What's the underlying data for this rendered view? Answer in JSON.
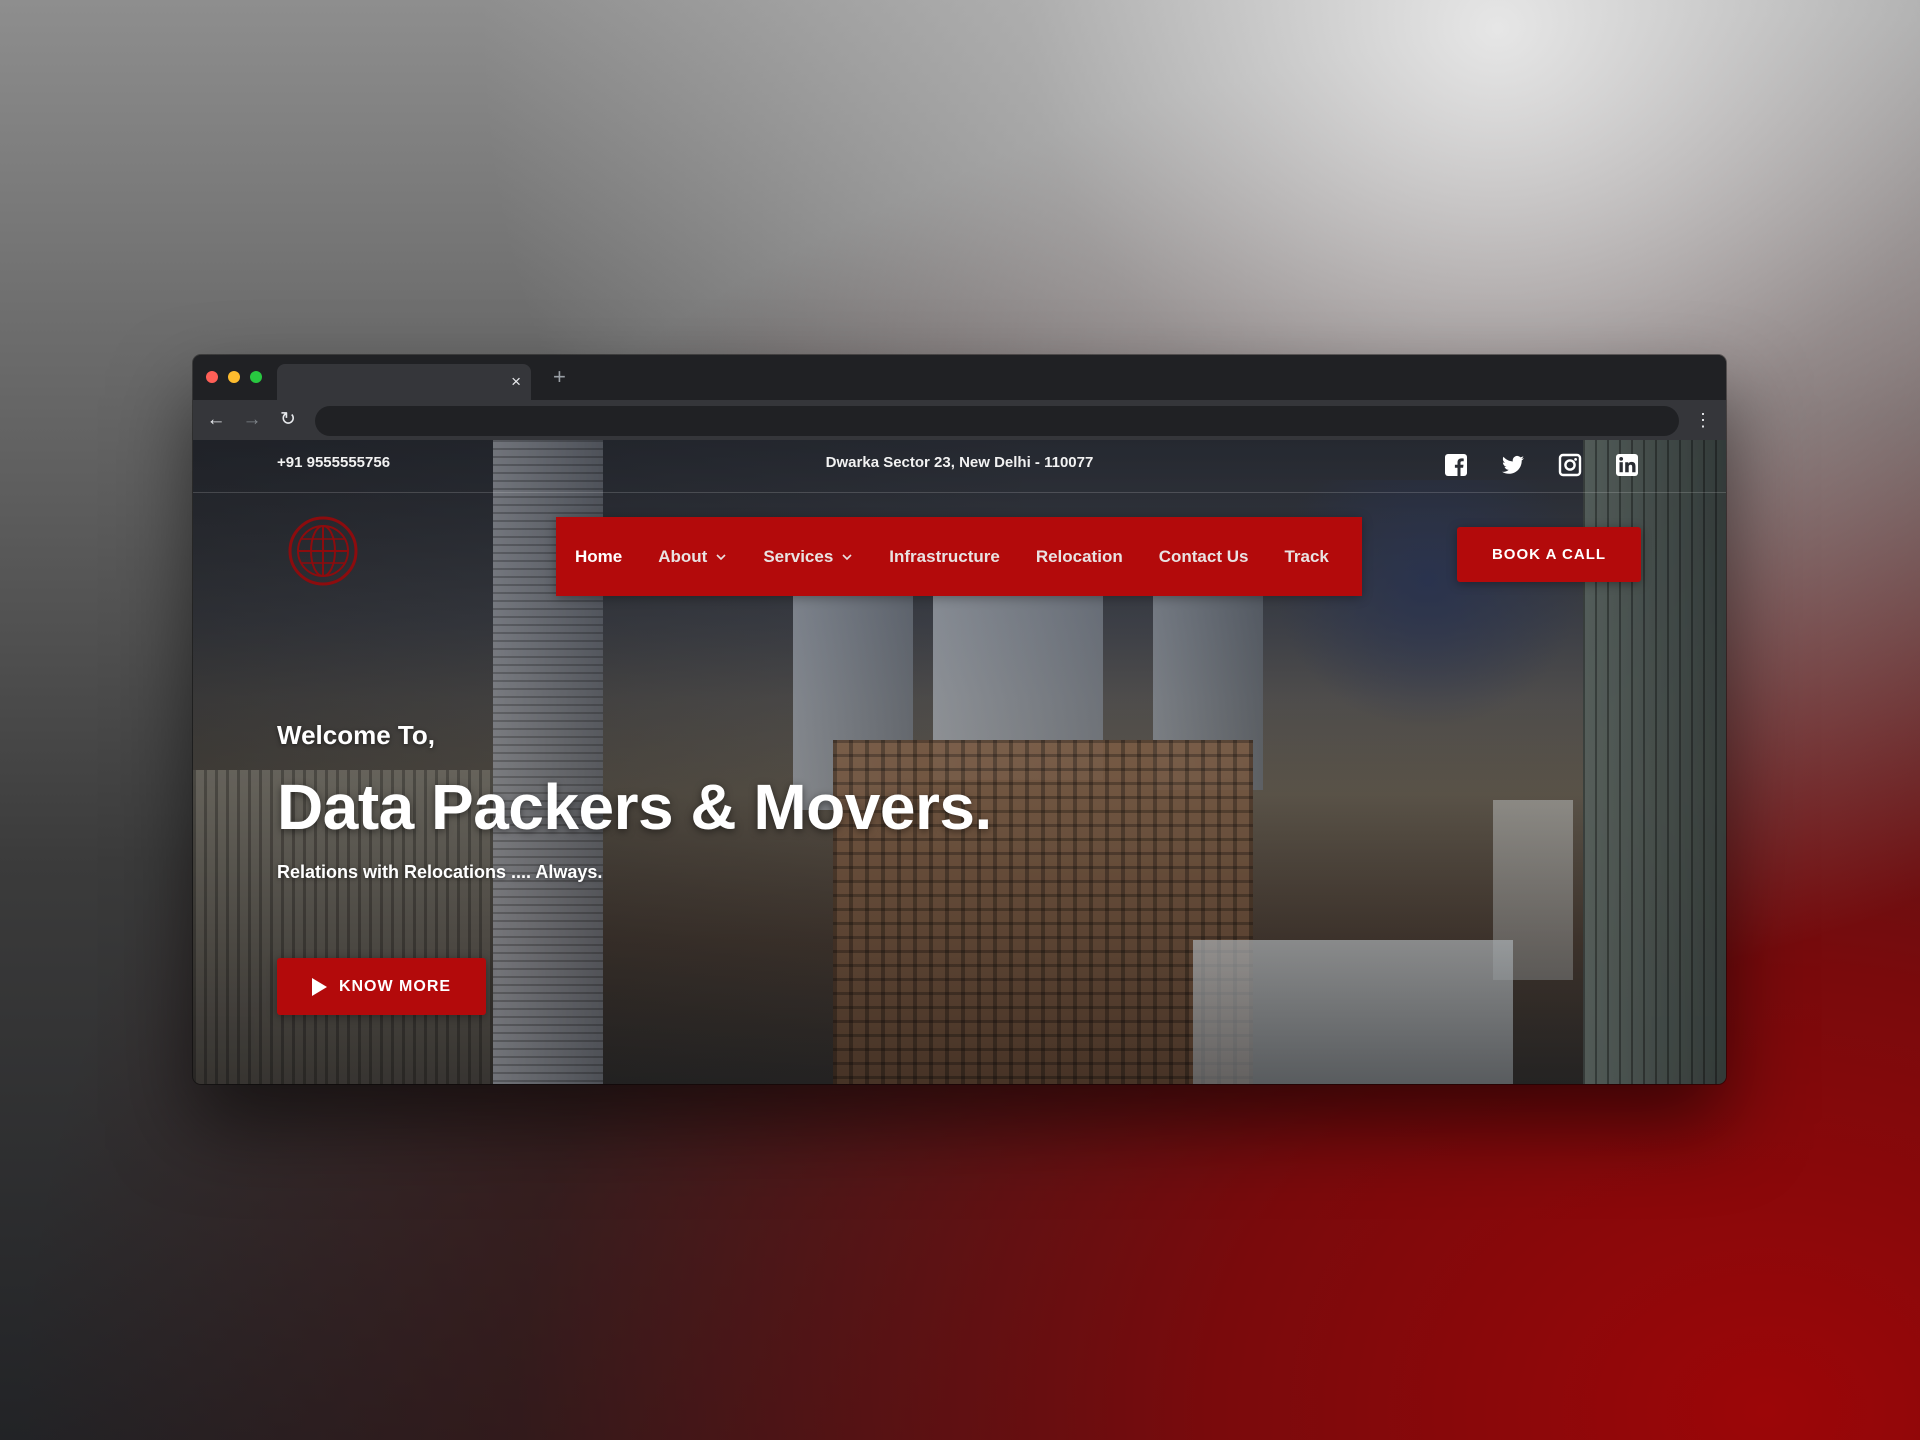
{
  "browser": {
    "tab_close": "×",
    "new_tab": "+",
    "back": "←",
    "forward": "→",
    "reload": "↻",
    "menu": "⋮"
  },
  "topbar": {
    "phone": "+91 9555555756",
    "address": "Dwarka Sector 23, New Delhi - 110077",
    "social_icons": [
      "facebook-icon",
      "twitter-icon",
      "instagram-icon",
      "linkedin-icon"
    ]
  },
  "nav": {
    "items": [
      {
        "label": "Home"
      },
      {
        "label": "About"
      },
      {
        "label": "Services"
      },
      {
        "label": "Infrastructure"
      },
      {
        "label": "Relocation"
      },
      {
        "label": "Contact Us"
      },
      {
        "label": "Track"
      }
    ],
    "cta": "BOOK A CALL"
  },
  "hero": {
    "welcome": "Welcome To,",
    "headline": "Data Packers & Movers.",
    "tagline": "Relations with Relocations .... Always.",
    "button": "KNOW MORE"
  },
  "colors": {
    "accent": "#b30a0b",
    "text": "#ffffff",
    "browser_chrome": "#202124"
  }
}
